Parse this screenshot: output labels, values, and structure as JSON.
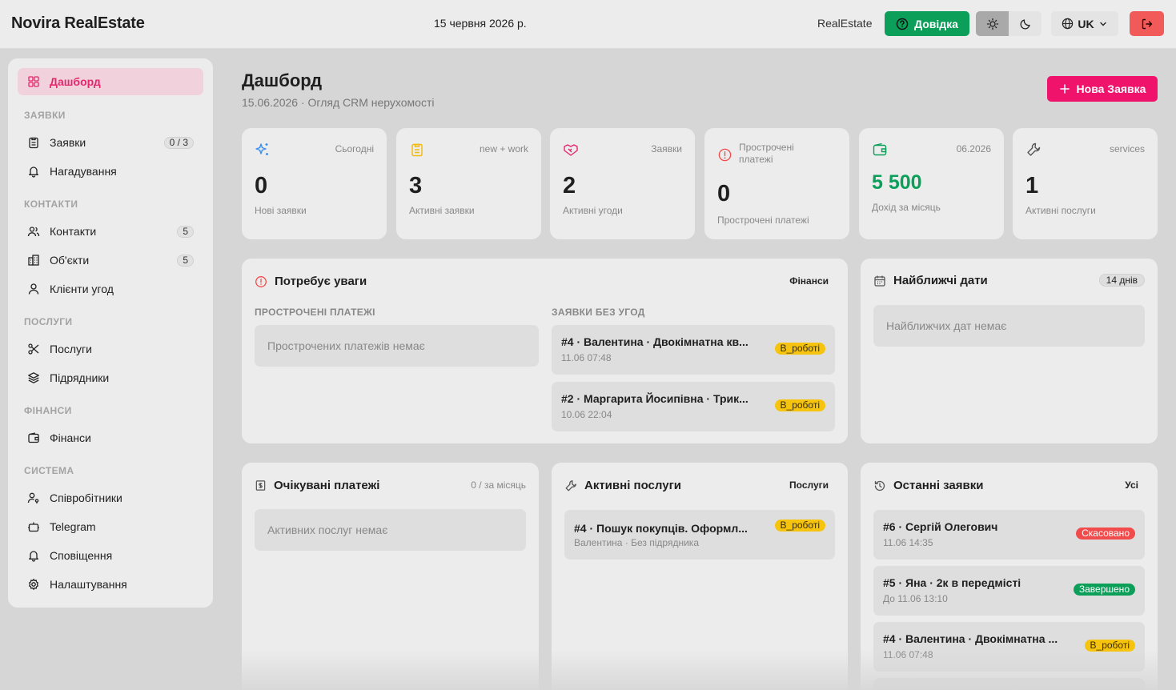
{
  "topbar": {
    "brand": "Novira RealEstate",
    "date": "15 червня 2026 р.",
    "realestate_link": "RealEstate",
    "help_label": "Довідка",
    "lang_label": "UK"
  },
  "sidebar": {
    "active_item": "Дашборд",
    "sections": [
      {
        "label": "ЗАЯВКИ"
      },
      {
        "label": "КОНТАКТИ"
      },
      {
        "label": "ПОСЛУГИ"
      },
      {
        "label": "ФІНАНСИ"
      },
      {
        "label": "СИСТЕМА"
      }
    ],
    "items": [
      {
        "label": "Заявки",
        "count": "0 / 3"
      },
      {
        "label": "Нагадування"
      },
      {
        "label": "Контакти",
        "count": "5"
      },
      {
        "label": "Об'єкти",
        "count": "5"
      },
      {
        "label": "Клієнти угод"
      },
      {
        "label": "Послуги"
      },
      {
        "label": "Підрядники"
      },
      {
        "label": "Фінанси"
      },
      {
        "label": "Співробітники"
      },
      {
        "label": "Telegram"
      },
      {
        "label": "Сповіщення"
      },
      {
        "label": "Налаштування"
      }
    ]
  },
  "header": {
    "title": "Дашборд",
    "subtitle": "15.06.2026 · Огляд CRM нерухомості",
    "new_button": "Нова Заявка"
  },
  "stats": [
    {
      "tag": "Сьогодні",
      "value": "0",
      "label": "Нові заявки"
    },
    {
      "tag": "new + work",
      "value": "3",
      "label": "Активні заявки"
    },
    {
      "tag": "Заявки",
      "value": "2",
      "label": "Активні угоди"
    },
    {
      "tag": "Прострочені платежі",
      "value": "0",
      "label": "Прострочені платежі"
    },
    {
      "tag": "06.2026",
      "value": "5 500",
      "label": "Дохід за місяць"
    },
    {
      "tag": "services",
      "value": "1",
      "label": "Активні послуги"
    }
  ],
  "attention": {
    "title": "Потребує уваги",
    "link": "Фінанси",
    "overdue_head": "ПРОСТРОЧЕНІ ПЛАТЕЖІ",
    "overdue_empty": "Прострочених платежів немає",
    "nodeal_head": "ЗАЯВКИ БЕЗ УГОД",
    "nodeal_items": [
      {
        "title": "#4 · Валентина · Двокімнатна кв...",
        "sub": "11.06 07:48",
        "badge": "В_роботі"
      },
      {
        "title": "#2 · Маргарита Йосипівна · Трик...",
        "sub": "10.06 22:04",
        "badge": "В_роботі"
      }
    ]
  },
  "dates": {
    "title": "Найближчі дати",
    "pill": "14 днів",
    "empty": "Найближчих дат немає"
  },
  "payments": {
    "title": "Очікувані платежі",
    "note": "0 / за місяць",
    "empty": "Активних послуг немає"
  },
  "services": {
    "title": "Активні послуги",
    "link": "Послуги",
    "items": [
      {
        "title": "#4 · Пошук покупців. Оформл...",
        "sub": "Валентина · Без підрядника",
        "badge": "В_роботі"
      }
    ]
  },
  "recent": {
    "title": "Останні заявки",
    "link": "Усі",
    "items": [
      {
        "title": "#6 · Сергій Олегович",
        "sub": "11.06 14:35",
        "badge": "Скасовано"
      },
      {
        "title": "#5 · Яна · 2к в передмісті",
        "sub": "До 11.06 13:10",
        "badge": "Завершено"
      },
      {
        "title": "#4 · Валентина · Двокімнатна ...",
        "sub": "11.06 07:48",
        "badge": "В_роботі"
      }
    ]
  },
  "colors": {
    "accent": "#f0136b",
    "success": "#0c9f5a",
    "warning": "#f6c40e",
    "danger": "#f24b4b"
  }
}
